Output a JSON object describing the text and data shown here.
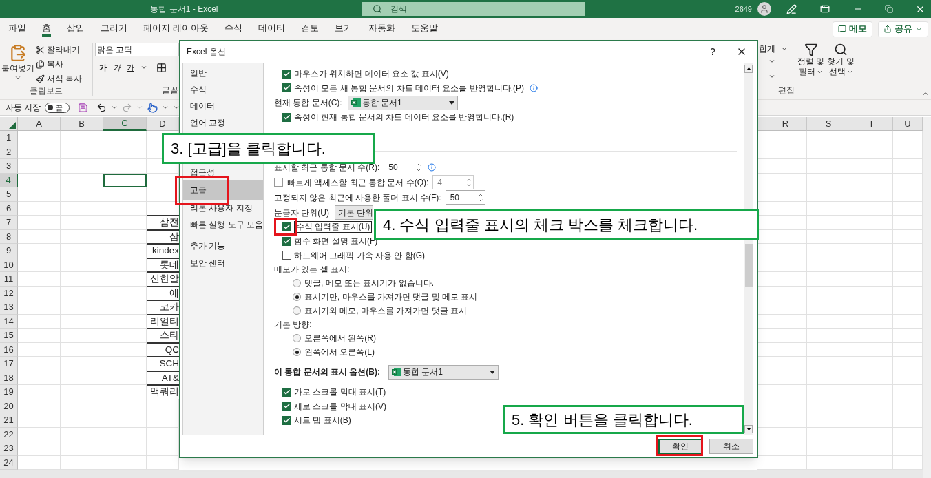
{
  "window": {
    "title": "통합 문서1 - Excel",
    "search_placeholder": "검색",
    "count": "2649"
  },
  "menu_tabs": [
    {
      "label": "파일",
      "selected": false
    },
    {
      "label": "홈",
      "selected": true
    },
    {
      "label": "삽입",
      "selected": false
    },
    {
      "label": "그리기",
      "selected": false
    },
    {
      "label": "페이지 레이아웃",
      "selected": false
    },
    {
      "label": "수식",
      "selected": false
    },
    {
      "label": "데이터",
      "selected": false
    },
    {
      "label": "검토",
      "selected": false
    },
    {
      "label": "보기",
      "selected": false
    },
    {
      "label": "자동화",
      "selected": false
    },
    {
      "label": "도움말",
      "selected": false
    }
  ],
  "share_buttons": [
    {
      "label": "메모",
      "kind": "memo"
    },
    {
      "label": "공유",
      "kind": "share"
    }
  ],
  "ribbon": {
    "paste": "붙여넣기",
    "clipboard_items": [
      {
        "label": "잘라내기",
        "kind": "cut"
      },
      {
        "label": "복사",
        "kind": "copy"
      },
      {
        "label": "서식 복사",
        "kind": "format"
      }
    ],
    "clipboard_label": "클립보드",
    "font_name": "맑은 고딕",
    "font_styles": [
      {
        "label": "가",
        "kind": "bold"
      },
      {
        "label": "가",
        "kind": "italic"
      },
      {
        "label": "가",
        "kind": "underline"
      }
    ],
    "font_label": "글꼴",
    "autosum": "합계",
    "sort_filter": [
      "정렬 및",
      "필터"
    ],
    "find_select": [
      "찾기 및",
      "선택"
    ],
    "editing_label": "편집"
  },
  "quick_access": {
    "autosave_label": "자동 저장",
    "autosave_toggle": {
      "label": "끔",
      "on": false
    }
  },
  "sheet": {
    "columns_left": [
      {
        "label": "A",
        "selected": false
      },
      {
        "label": "B",
        "selected": false
      },
      {
        "label": "C",
        "selected": true
      },
      {
        "label": "D",
        "selected": false
      }
    ],
    "columns_right": [
      {
        "label": "R",
        "selected": false
      },
      {
        "label": "S",
        "selected": false
      },
      {
        "label": "T",
        "selected": false
      },
      {
        "label": "U",
        "selected": false
      }
    ],
    "rows": [
      {
        "number": "1",
        "selected": false,
        "boxed": false
      },
      {
        "number": "2",
        "selected": false,
        "boxed": false
      },
      {
        "number": "3",
        "selected": false,
        "boxed": false
      },
      {
        "number": "4",
        "selected": true,
        "boxed": false
      },
      {
        "number": "5",
        "selected": false,
        "boxed": false
      },
      {
        "number": "6",
        "selected": false,
        "boxed": true
      },
      {
        "number": "7",
        "selected": false,
        "boxed": true,
        "column_d": "삼전"
      },
      {
        "number": "8",
        "selected": false,
        "boxed": true,
        "column_d": "삼"
      },
      {
        "number": "9",
        "selected": false,
        "boxed": true,
        "column_d": "kindex"
      },
      {
        "number": "10",
        "selected": false,
        "boxed": true,
        "column_d": "롯데"
      },
      {
        "number": "11",
        "selected": false,
        "boxed": true,
        "column_d": "신한알"
      },
      {
        "number": "12",
        "selected": false,
        "boxed": true,
        "column_d": "애"
      },
      {
        "number": "13",
        "selected": false,
        "boxed": true,
        "column_d": "코카"
      },
      {
        "number": "14",
        "selected": false,
        "boxed": true,
        "column_d": "리얼티"
      },
      {
        "number": "15",
        "selected": false,
        "boxed": true,
        "column_d": "스타"
      },
      {
        "number": "16",
        "selected": false,
        "boxed": true,
        "column_d": "QC"
      },
      {
        "number": "17",
        "selected": false,
        "boxed": true,
        "column_d": "SCH"
      },
      {
        "number": "18",
        "selected": false,
        "boxed": true,
        "column_d": "AT&"
      },
      {
        "number": "19",
        "selected": false,
        "boxed": true,
        "column_d": "맥쿼리"
      },
      {
        "number": "20",
        "selected": false,
        "boxed": false
      },
      {
        "number": "21",
        "selected": false,
        "boxed": false
      },
      {
        "number": "22",
        "selected": false,
        "boxed": false
      },
      {
        "number": "23",
        "selected": false,
        "boxed": false
      },
      {
        "number": "24",
        "selected": false,
        "boxed": false
      }
    ]
  },
  "dialog": {
    "title": "Excel 옵션",
    "help": "?",
    "nav": [
      {
        "label": "일반",
        "selected": false,
        "highlighted": false,
        "divider_above": false
      },
      {
        "label": "수식",
        "selected": false,
        "highlighted": false,
        "divider_above": false
      },
      {
        "label": "데이터",
        "selected": false,
        "highlighted": false,
        "divider_above": false
      },
      {
        "label": "언어 교정",
        "selected": false,
        "highlighted": false,
        "divider_above": false
      },
      {
        "label": "접근성",
        "selected": false,
        "highlighted": false,
        "divider_above": false
      },
      {
        "label": "고급",
        "selected": true,
        "highlighted": true,
        "divider_above": false
      },
      {
        "label": "리본 사용자 지정",
        "selected": false,
        "highlighted": false,
        "divider_above": false
      },
      {
        "label": "빠른 실행 도구 모음",
        "selected": false,
        "highlighted": false,
        "divider_above": false
      },
      {
        "label": "추가 기능",
        "selected": false,
        "highlighted": false,
        "divider_above": true
      },
      {
        "label": "보안 센터",
        "selected": false,
        "highlighted": false,
        "divider_above": false
      }
    ],
    "options": [
      {
        "kind": "check",
        "label": "마우스가 위치하면 데이터 요소 값 표시(V)",
        "checked": true
      },
      {
        "kind": "check",
        "label": "속성이 모든 새 통합 문서의 차트 데이터 요소를 반영합니다.(P)",
        "checked": true,
        "info": true
      },
      {
        "kind": "dropdown",
        "label": "현재 통합 문서(C):",
        "value": "통합 문서1",
        "excel": true
      },
      {
        "kind": "check",
        "label": "속성이 현재 통합 문서의 차트 데이터 요소를 반영합니다.(R)",
        "checked": true
      },
      {
        "kind": "spin",
        "label": "표시할 최근 통합 문서 수(R):",
        "value": "50",
        "info": true,
        "divider_above": true
      },
      {
        "kind": "check_spin",
        "label": "빠르게 액세스할 최근 통합 문서 수(Q):",
        "value": "4",
        "checked": false,
        "disabled": true
      },
      {
        "kind": "spin",
        "label": "고정되지 않은 최근에 사용한 폴더 표시 수(F):",
        "value": "50"
      },
      {
        "kind": "dropdown",
        "label": "눈금자 단위(U)",
        "value": "기본 단위"
      },
      {
        "kind": "check",
        "label": "수식 입력줄 표시(U)",
        "checked": true,
        "focused": true,
        "highlighted": true
      },
      {
        "kind": "check",
        "label": "함수 화면 설명 표시(F)",
        "checked": true
      },
      {
        "kind": "check",
        "label": "하드웨어 그래픽 가속 사용 안 함(G)",
        "checked": false
      },
      {
        "kind": "label",
        "label": "메모가 있는 셀 표시:"
      },
      {
        "kind": "radio",
        "label": "댓글, 메모 또는 표시기가 없습니다.",
        "selected": false
      },
      {
        "kind": "radio",
        "label": "표시기만, 마우스를 가져가면 댓글 및 메모 표시",
        "selected": true
      },
      {
        "kind": "radio",
        "label": "표시기와 메모, 마우스를 가져가면 댓글 표시",
        "selected": false
      },
      {
        "kind": "label",
        "label": "기본 방향:"
      },
      {
        "kind": "radio",
        "label": "오른쪽에서 왼쪽(R)",
        "selected": false
      },
      {
        "kind": "radio",
        "label": "왼쪽에서 오른쪽(L)",
        "selected": true
      },
      {
        "kind": "section",
        "label": "이 통합 문서의 표시 옵션(B):",
        "value": "통합 문서1",
        "excel": true
      },
      {
        "kind": "check",
        "label": "가로 스크롤 막대 표시(T)",
        "checked": true
      },
      {
        "kind": "check",
        "label": "세로 스크롤 막대 표시(V)",
        "checked": true
      },
      {
        "kind": "check",
        "label": "시트 탭 표시(B)",
        "checked": true
      }
    ],
    "buttons": [
      {
        "label": "확인",
        "selected": true,
        "highlighted": true
      },
      {
        "label": "취소",
        "selected": false,
        "highlighted": false
      }
    ]
  },
  "callouts": [
    {
      "text": "3. [고급]을 클릭합니다."
    },
    {
      "text": "4. 수식 입력줄 표시의 체크 박스를 체크합니다."
    },
    {
      "text": "5. 확인 버튼을 클릭합니다."
    }
  ]
}
